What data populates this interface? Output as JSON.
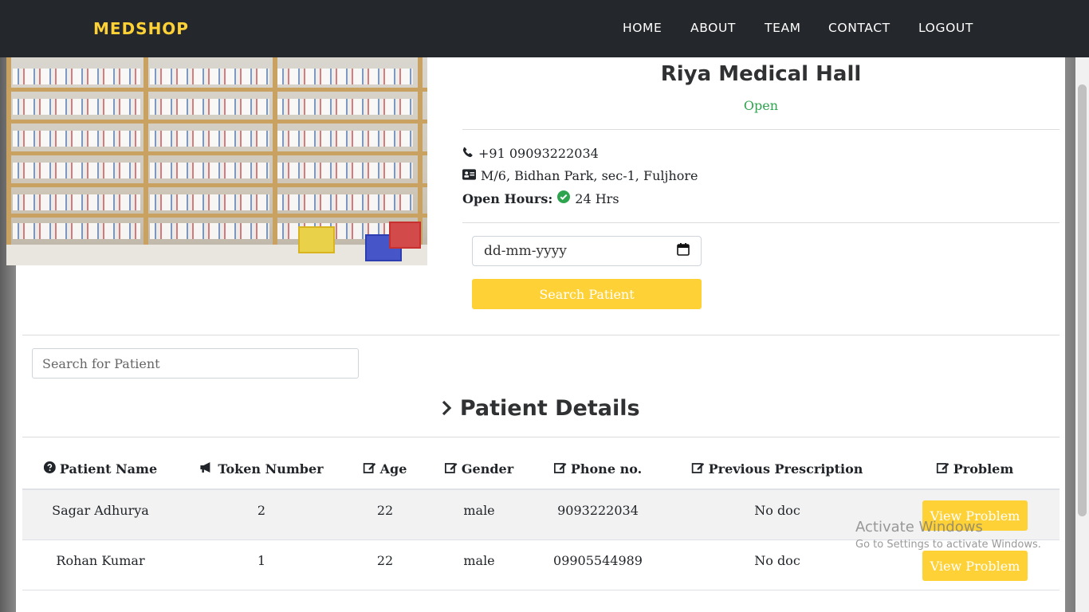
{
  "navbar": {
    "brand": "MEDSHOP",
    "links": [
      "HOME",
      "ABOUT",
      "TEAM",
      "CONTACT",
      "LOGOUT"
    ]
  },
  "store": {
    "name": "Riya Medical Hall",
    "status": "Open",
    "phone": "+91 09093222034",
    "address": "M/6, Bidhan Park, sec-1, Fuljhore",
    "hours_label": "Open Hours:",
    "hours_value": "24 Hrs"
  },
  "date_filter": {
    "placeholder": "dd-mm-yyyy",
    "button_label": "Search Patient"
  },
  "patient_search": {
    "placeholder": "Search for Patient"
  },
  "section_title": "Patient Details",
  "table": {
    "headers": [
      "Patient Name",
      "Token Number",
      "Age",
      "Gender",
      "Phone no.",
      "Previous Prescription",
      "Problem"
    ],
    "rows": [
      {
        "name": "Sagar Adhurya",
        "token": "2",
        "age": "22",
        "gender": "male",
        "phone": "9093222034",
        "prescription": "No doc",
        "action": "View Problem"
      },
      {
        "name": "Rohan Kumar",
        "token": "1",
        "age": "22",
        "gender": "male",
        "phone": "09905544989",
        "prescription": "No doc",
        "action": "View Problem"
      }
    ]
  },
  "watermark": {
    "line1": "Activate Windows",
    "line2": "Go to Settings to activate Windows."
  },
  "colors": {
    "navbar_bg": "#24272b",
    "brand_yellow": "#fed136",
    "status_green": "#2ea44f"
  },
  "icons": [
    "phone-icon",
    "address-card-icon",
    "check-circle-icon",
    "calendar-icon",
    "chevron-right-icon",
    "question-circle-icon",
    "bullhorn-icon",
    "edit-icon"
  ]
}
